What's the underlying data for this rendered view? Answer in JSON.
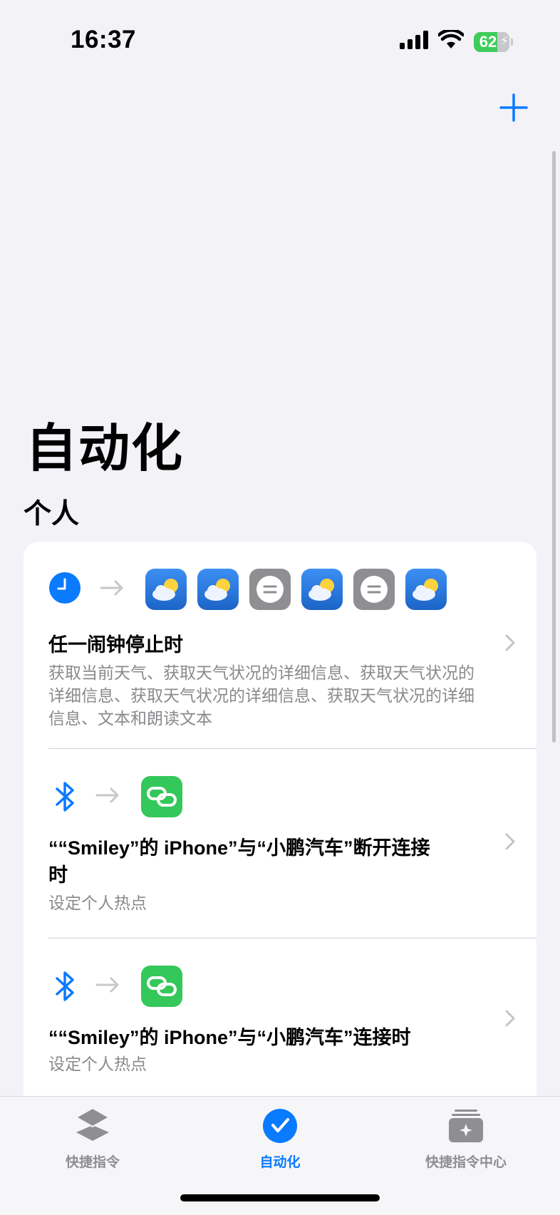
{
  "status": {
    "time": "16:37",
    "battery": "62"
  },
  "header": {
    "title": "自动化"
  },
  "section": {
    "title": "个人"
  },
  "automations": [
    {
      "trigger_icon": "clock-icon",
      "actions": [
        "weather-icon",
        "weather-icon",
        "text-icon",
        "weather-icon",
        "text-icon",
        "weather-icon"
      ],
      "title": "任一闹钟停止时",
      "subtitle": "获取当前天气、获取天气状况的详细信息、获取天气状况的详细信息、获取天气状况的详细信息、获取天气状况的详细信息、文本和朗读文本"
    },
    {
      "trigger_icon": "bluetooth-icon",
      "actions": [
        "link-icon"
      ],
      "title": "““Smiley”的 iPhone”与“小鹏汽车”断开连接时",
      "subtitle": "设定个人热点"
    },
    {
      "trigger_icon": "bluetooth-icon",
      "actions": [
        "link-icon"
      ],
      "title": "““Smiley”的 iPhone”与“小鹏汽车”连接时",
      "subtitle": "设定个人热点"
    }
  ],
  "tabs": [
    {
      "label": "快捷指令",
      "icon": "layers-icon",
      "active": false
    },
    {
      "label": "自动化",
      "icon": "checkmark-circle-icon",
      "active": true
    },
    {
      "label": "快捷指令中心",
      "icon": "gallery-icon",
      "active": false
    }
  ],
  "colors": {
    "accent": "#0a7aff",
    "inactive_tab": "#8e8e93",
    "link_tile": "#34c759",
    "background": "#f2f2f7"
  }
}
